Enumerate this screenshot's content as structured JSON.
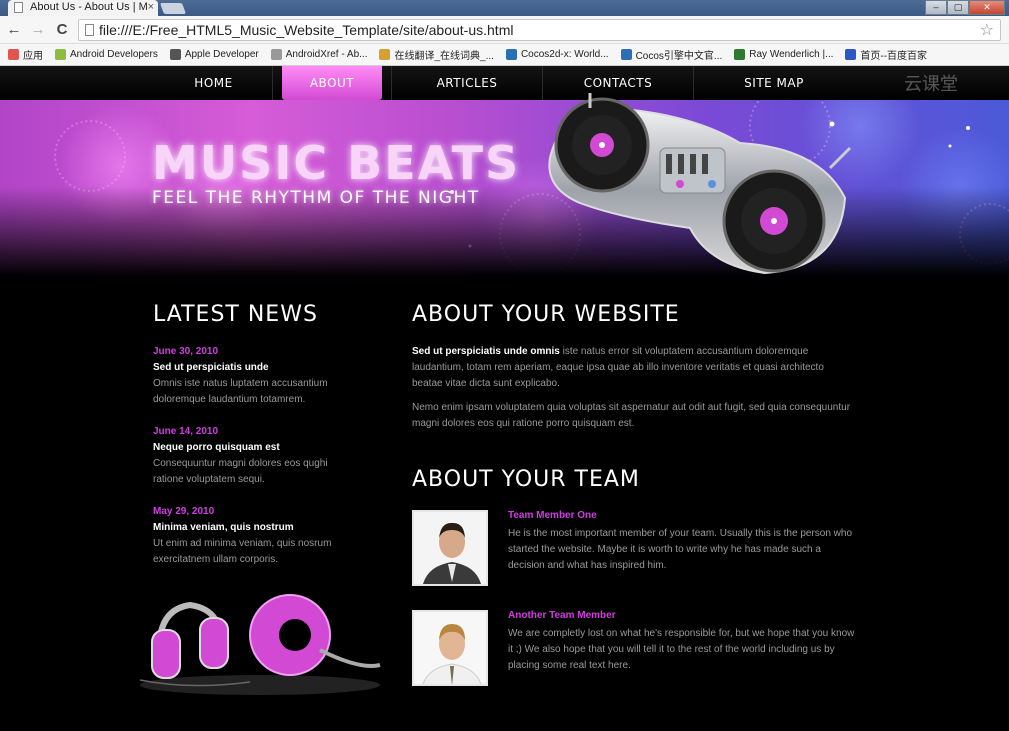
{
  "browser": {
    "tab_title": "About Us - About Us | M",
    "tab_close": "×",
    "url": "file:///E:/Free_HTML5_Music_Website_Template/site/about-us.html",
    "back_label": "←",
    "forward_label": "→",
    "reload_label": "C",
    "star_label": "☆",
    "window_buttons": [
      "–",
      "▢",
      "✕"
    ],
    "bookmarks": [
      {
        "label": "应用",
        "color": "#e0554f"
      },
      {
        "label": "Android Developers",
        "color": "#8cbd3f"
      },
      {
        "label": "Apple Developer",
        "color": "#555555"
      },
      {
        "label": "AndroidXref - Ab...",
        "color": "#999999"
      },
      {
        "label": "在线翻译_在线词典_...",
        "color": "#d8a030"
      },
      {
        "label": "Cocos2d-x: World...",
        "color": "#2a6fb5"
      },
      {
        "label": "Cocos引擎中文官...",
        "color": "#2a6fb5"
      },
      {
        "label": "Ray Wenderlich |...",
        "color": "#2f7a2f"
      },
      {
        "label": "首页--百度百家",
        "color": "#2a56c6"
      }
    ]
  },
  "site": {
    "nav": [
      "HOME",
      "ABOUT",
      "ARTICLES",
      "CONTACTS",
      "SITE MAP"
    ],
    "watermark": "云课堂",
    "logo_title": "MUSIC BEATS",
    "logo_subtitle": "FEEL THE RHYTHM OF THE NIGHT",
    "latest_news": {
      "heading": "LATEST NEWS",
      "items": [
        {
          "date": "June 30, 2010",
          "title": "Sed ut perspiciatis unde",
          "text": "Omnis iste natus luptatem accusantium doloremque laudantium totamrem."
        },
        {
          "date": "June 14, 2010",
          "title": "Neque porro quisquam est",
          "text": "Consequuntur magni dolores eos qughi ratione voluptatem sequi."
        },
        {
          "date": "May 29, 2010",
          "title": "Minima veniam, quis nostrum",
          "text": "Ut enim ad minima veniam, quis nosrum exercitatnem ullam corporis."
        }
      ]
    },
    "about": {
      "heading": "ABOUT YOUR WEBSITE",
      "lead_bold": "Sed ut perspiciatis unde omnis",
      "p1_rest": " iste natus error sit voluptatem accusantium doloremque laudantium, totam rem aperiam, eaque ipsa quae ab illo inventore veritatis et quasi architecto beatae vitae dicta sunt explicabo.",
      "p2": "Nemo enim ipsam voluptatem quia voluptas sit aspernatur aut odit aut fugit, sed quia consequuntur magni dolores eos qui ratione porro quisquam est."
    },
    "team": {
      "heading": "ABOUT YOUR TEAM",
      "members": [
        {
          "name": "Team Member One",
          "text": "He is the most important member of your team. Usually this is the person who started the website. Maybe it is worth to write why he has made such a decision and what has inspired him."
        },
        {
          "name": "Another Team Member",
          "text": "We are completly lost on what he's responsible for, but we hope that you know it ;) We also hope that you will tell it to the rest of the world including us by placing some real text here."
        }
      ]
    }
  },
  "colors": {
    "accent": "#d03ee0",
    "nav_active": "#e86ee8",
    "body_text": "#9a9a9a"
  }
}
